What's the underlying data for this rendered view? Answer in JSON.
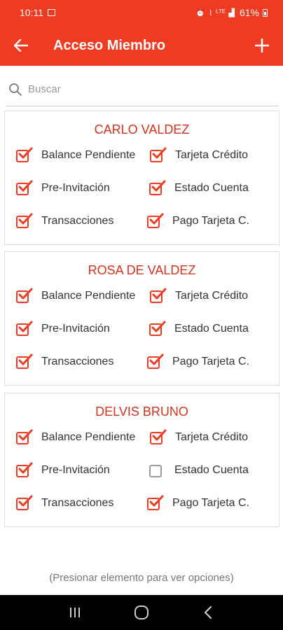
{
  "status_bar": {
    "time": "10:11",
    "battery": "61%",
    "network": "ᴸᵀᴱ"
  },
  "app_bar": {
    "title": "Acceso Miembro",
    "back_icon": "arrow-left-icon",
    "add_icon": "plus-icon"
  },
  "search": {
    "placeholder": "Buscar",
    "value": ""
  },
  "accent_color": "#ee3b22",
  "members": [
    {
      "name": "CARLO VALDEZ",
      "permissions": [
        {
          "label": "Balance Pendiente",
          "checked": true
        },
        {
          "label": "Tarjeta Crédito",
          "checked": true
        },
        {
          "label": "Pre-Invitación",
          "checked": true
        },
        {
          "label": "Estado Cuenta",
          "checked": true
        },
        {
          "label": "Transacciones",
          "checked": true
        },
        {
          "label": "Pago Tarjeta C.",
          "checked": true
        }
      ]
    },
    {
      "name": "ROSA DE VALDEZ",
      "permissions": [
        {
          "label": "Balance Pendiente",
          "checked": true
        },
        {
          "label": "Tarjeta Crédito",
          "checked": true
        },
        {
          "label": "Pre-Invitación",
          "checked": true
        },
        {
          "label": "Estado Cuenta",
          "checked": true
        },
        {
          "label": "Transacciones",
          "checked": true
        },
        {
          "label": "Pago Tarjeta C.",
          "checked": true
        }
      ]
    },
    {
      "name": "DELVIS BRUNO",
      "permissions": [
        {
          "label": "Balance Pendiente",
          "checked": true
        },
        {
          "label": "Tarjeta Crédito",
          "checked": true
        },
        {
          "label": "Pre-Invitación",
          "checked": true
        },
        {
          "label": "Estado Cuenta",
          "checked": false
        },
        {
          "label": "Transacciones",
          "checked": true
        },
        {
          "label": "Pago Tarjeta C.",
          "checked": true
        }
      ]
    }
  ],
  "hint": "(Presionar elemento para ver opciones)"
}
